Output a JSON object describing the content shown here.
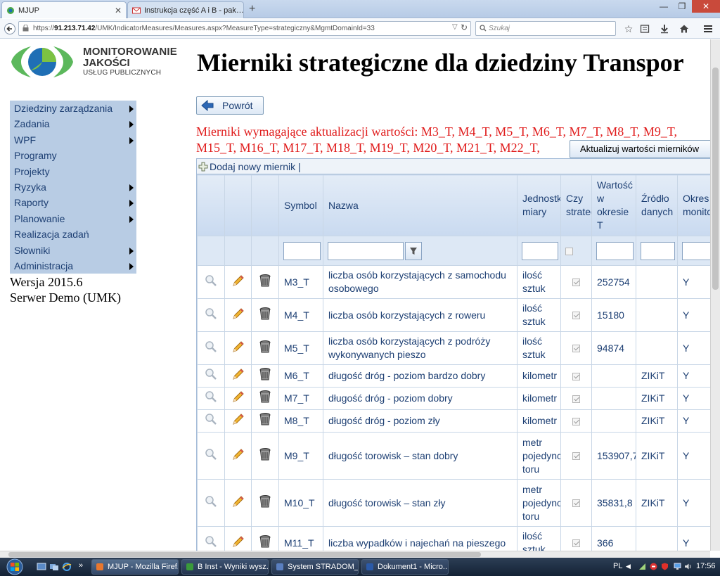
{
  "browser": {
    "tabs": [
      {
        "label": "MJUP",
        "active": true
      },
      {
        "label": "Instrukcja część A i B - pak…",
        "active": false
      }
    ],
    "new_tab": "+",
    "url_prefix": "https://",
    "url_host": "91.213.71.42",
    "url_path": "/UMK/IndicatorMeasures/Measures.aspx?MeasureType=strategiczny&MgmtDomainId=33",
    "search_placeholder": "Szukaj"
  },
  "logo": {
    "line1": "MONITOROWANIE",
    "line2": "JAKOŚCI",
    "line3": "USŁUG PUBLICZNYCH"
  },
  "page_title": "Mierniki strategiczne dla dziedziny Transpor",
  "menu": [
    {
      "label": "Dziedziny zarządzania",
      "arrow": true
    },
    {
      "label": "Zadania",
      "arrow": true
    },
    {
      "label": "WPF",
      "arrow": true
    },
    {
      "label": "Programy",
      "arrow": false
    },
    {
      "label": "Projekty",
      "arrow": false
    },
    {
      "label": "Ryzyka",
      "arrow": true
    },
    {
      "label": "Raporty",
      "arrow": true
    },
    {
      "label": "Planowanie",
      "arrow": true
    },
    {
      "label": "Realizacja zadań",
      "arrow": false
    },
    {
      "label": "Słowniki",
      "arrow": true
    },
    {
      "label": "Administracja",
      "arrow": true
    }
  ],
  "version": {
    "line1": "Wersja 2015.6",
    "line2": "Serwer Demo (UMK)"
  },
  "back_button": "Powrót",
  "alert": {
    "line1": "Mierniki wymagające aktualizacji wartości: M3_T, M4_T, M5_T, M6_T, M7_T, M8_T, M9_T,",
    "line2": "M15_T, M16_T, M17_T, M18_T, M19_T, M20_T, M21_T, M22_T,"
  },
  "update_button": "Aktualizuj wartości mierników",
  "grid": {
    "add_label": "Dodaj nowy miernik |",
    "columns": [
      "",
      "",
      "",
      "Symbol",
      "Nazwa",
      "Jednostka miary",
      "Czy strateg",
      "Wartość w okresie T",
      "Źródło danych",
      "Okres monito"
    ],
    "rows": [
      {
        "symbol": "M3_T",
        "name": "liczba osób korzystających z samochodu osobowego",
        "unit": "ilość sztuk",
        "strategic": true,
        "value": "252754",
        "source": "",
        "period": "Y",
        "size": "normal"
      },
      {
        "symbol": "M4_T",
        "name": "liczba osób korzystających z roweru",
        "unit": "ilość sztuk",
        "strategic": true,
        "value": "15180",
        "source": "",
        "period": "Y",
        "size": "normal"
      },
      {
        "symbol": "M5_T",
        "name": "liczba osób korzystających z podróży wykonywanych pieszo",
        "unit": "ilość sztuk",
        "strategic": true,
        "value": "94874",
        "source": "",
        "period": "Y",
        "size": "normal"
      },
      {
        "symbol": "M6_T",
        "name": "długość dróg - poziom bardzo dobry",
        "unit": "kilometr",
        "strategic": true,
        "value": "",
        "source": "ZIKiT",
        "period": "Y",
        "size": "short"
      },
      {
        "symbol": "M7_T",
        "name": "długość dróg - poziom dobry",
        "unit": "kilometr",
        "strategic": true,
        "value": "",
        "source": "ZIKiT",
        "period": "Y",
        "size": "short"
      },
      {
        "symbol": "M8_T",
        "name": "długość dróg - poziom zły",
        "unit": "kilometr",
        "strategic": true,
        "value": "",
        "source": "ZIKiT",
        "period": "Y",
        "size": "short"
      },
      {
        "symbol": "M9_T",
        "name": "długość torowisk – stan dobry",
        "unit": "metr pojedyncz toru",
        "strategic": true,
        "value": "153907,7",
        "source": "ZIKiT",
        "period": "Y",
        "size": "tall"
      },
      {
        "symbol": "M10_T",
        "name": "długość torowisk – stan zły",
        "unit": "metr pojedyncz toru",
        "strategic": true,
        "value": "35831,8",
        "source": "ZIKiT",
        "period": "Y",
        "size": "tall"
      },
      {
        "symbol": "M11_T",
        "name": "liczba wypadków i najechań na pieszego",
        "unit": "ilość sztuk",
        "strategic": true,
        "value": "366",
        "source": "",
        "period": "Y",
        "size": "normal"
      }
    ]
  },
  "taskbar": {
    "tasks": [
      {
        "label": "MJUP - Mozilla Firef...",
        "active": true
      },
      {
        "label": "B Inst - Wyniki wysz...",
        "active": false
      },
      {
        "label": "System STRADOM_...",
        "active": false
      },
      {
        "label": "Dokument1 - Micro...",
        "active": false
      }
    ],
    "lang": "PL",
    "time": "17:56"
  }
}
